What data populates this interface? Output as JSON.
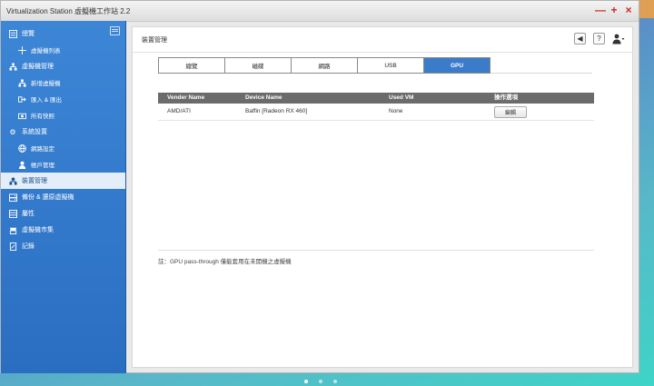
{
  "window": {
    "title": "Virtualization Station 虛擬機工作站 2.2",
    "controls": [
      "—",
      "+",
      "×"
    ]
  },
  "sidebar": {
    "items": [
      {
        "label": "總覽",
        "icon": "list-icon",
        "level": 0
      },
      {
        "label": "虛擬機列表",
        "icon": "plus-icon",
        "level": 1
      },
      {
        "label": "虛擬機管理",
        "icon": "network-icon",
        "level": 0
      },
      {
        "label": "新增虛擬機",
        "icon": "network-icon",
        "level": 1
      },
      {
        "label": "匯入 & 匯出",
        "icon": "import-icon",
        "level": 1
      },
      {
        "label": "所有快照",
        "icon": "snapshot-icon",
        "level": 1
      },
      {
        "label": "系統設置",
        "icon": "gear-icon",
        "level": 0
      },
      {
        "label": "網路設定",
        "icon": "globe-icon",
        "level": 1
      },
      {
        "label": "帳戶管理",
        "icon": "user-icon",
        "level": 1
      },
      {
        "label": "裝置管理",
        "icon": "devices-icon",
        "level": 0,
        "active": true
      },
      {
        "label": "備份 & 還原虛擬機",
        "icon": "backup-icon",
        "level": 0
      },
      {
        "label": "屬性",
        "icon": "properties-icon",
        "level": 0
      },
      {
        "label": "虛擬機市集",
        "icon": "store-icon",
        "level": 0
      },
      {
        "label": "記錄",
        "icon": "log-icon",
        "level": 0
      }
    ]
  },
  "main": {
    "page_title": "裝置管理",
    "tabs": [
      {
        "label": "總覽"
      },
      {
        "label": "磁碟"
      },
      {
        "label": "網路"
      },
      {
        "label": "USB"
      },
      {
        "label": "GPU",
        "active": true
      }
    ],
    "table": {
      "headers": [
        "Vender Name",
        "Device Name",
        "Used VM",
        "操作選項"
      ],
      "rows": [
        {
          "vendor": "AMD/ATI",
          "device": "Baffin [Radeon RX 460]",
          "used_vm": "None",
          "action": "編輯"
        }
      ]
    },
    "note": "註：GPU pass-through 僅能套用在未開機之虛擬機"
  },
  "colors": {
    "accent": "#3a7cc9",
    "sidebar": "#2f78cc",
    "header": "#6b6b6b"
  }
}
